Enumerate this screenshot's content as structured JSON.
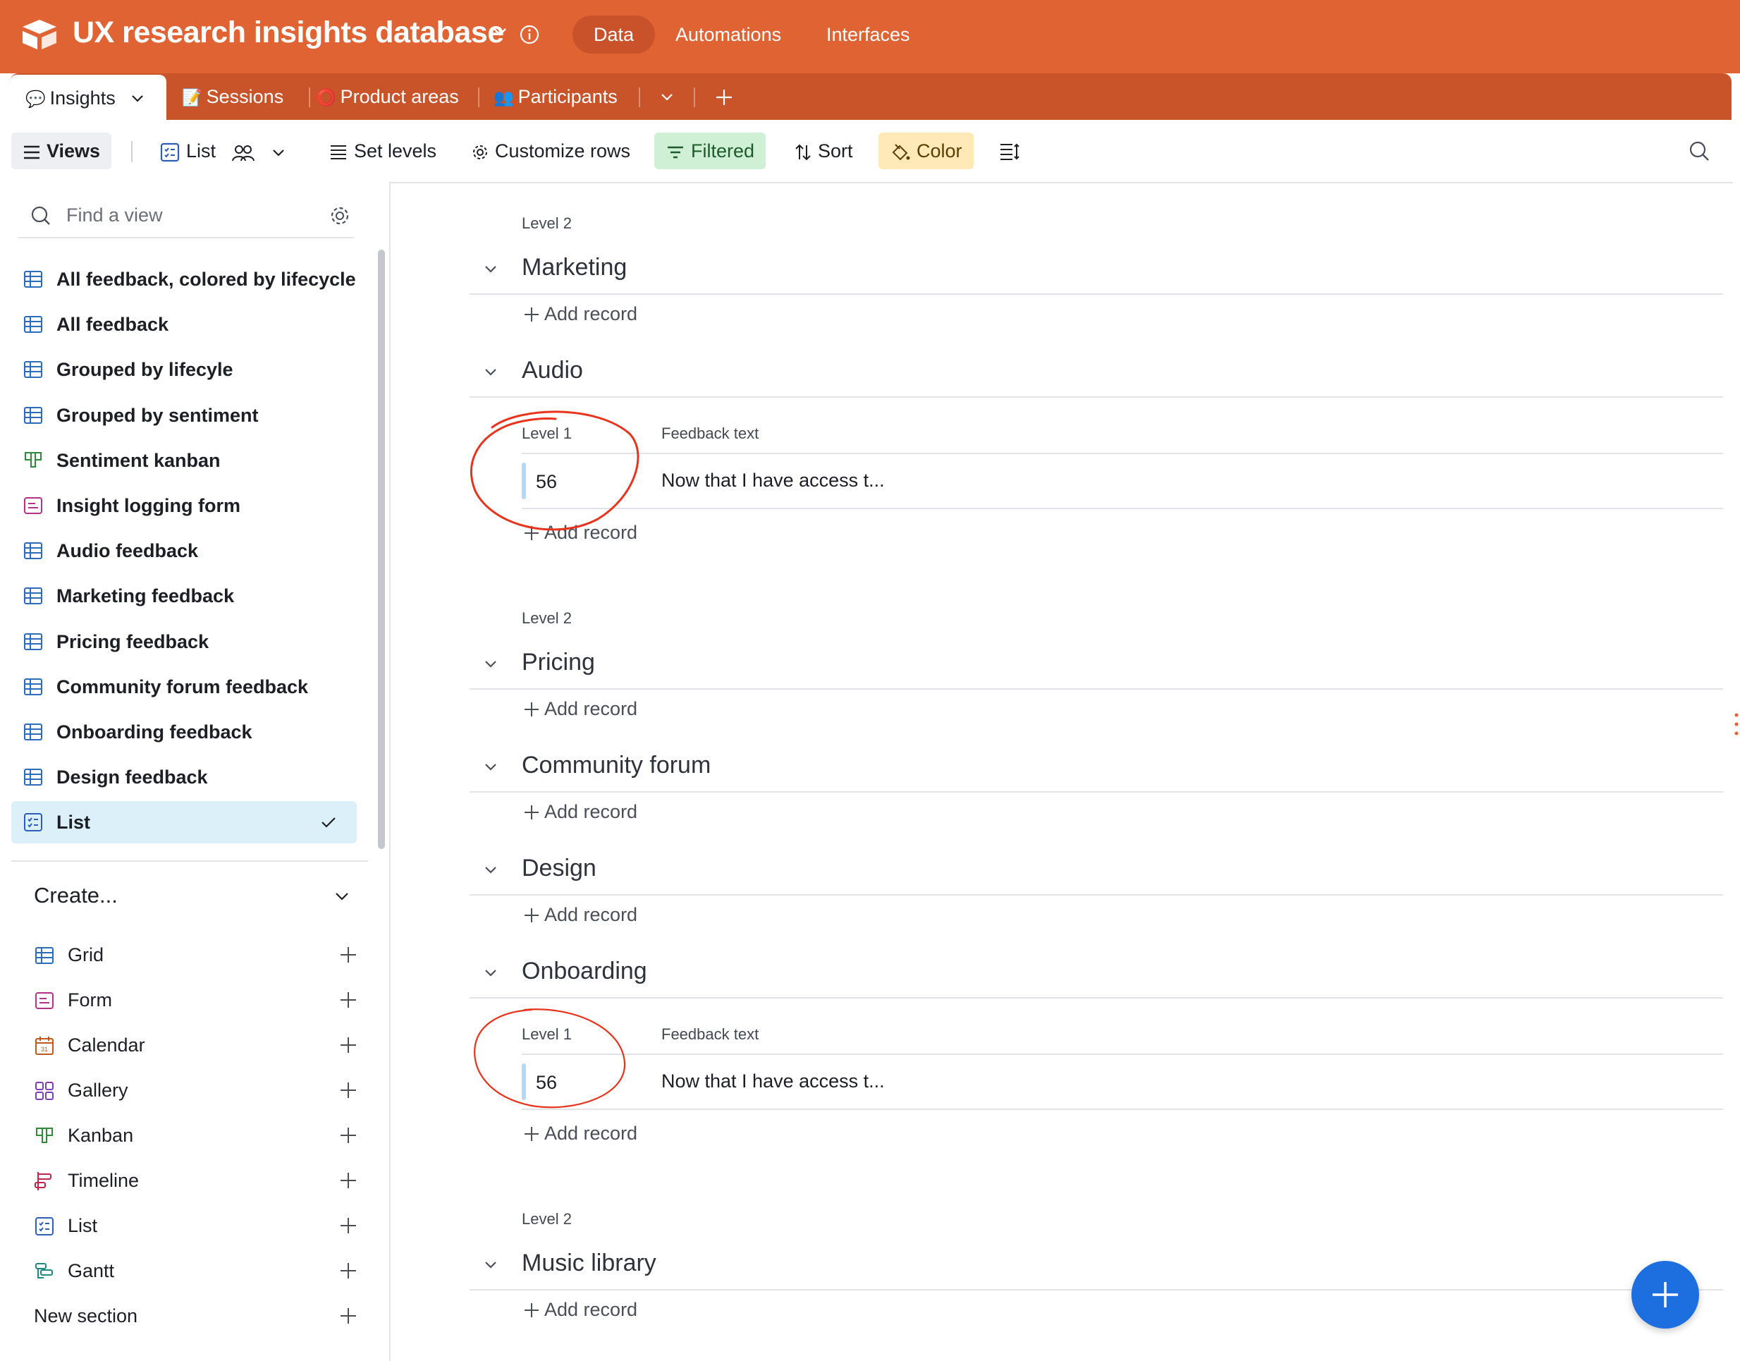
{
  "app": {
    "title": "UX research insights database",
    "nav": [
      "Data",
      "Automations",
      "Interfaces"
    ],
    "active_nav": "Data"
  },
  "tabs": [
    {
      "emoji": "💬",
      "label": "Insights"
    },
    {
      "emoji": "📝",
      "label": "Sessions"
    },
    {
      "emoji": "⭕",
      "label": "Product areas"
    },
    {
      "emoji": "👥",
      "label": "Participants"
    }
  ],
  "toolbar": {
    "views": "Views",
    "list": "List",
    "set_levels": "Set levels",
    "customize_rows": "Customize rows",
    "filtered": "Filtered",
    "sort": "Sort",
    "color": "Color"
  },
  "sidebar": {
    "find_placeholder": "Find a view",
    "views": [
      {
        "label": "All feedback, colored by lifecycle",
        "icon": "grid-icon"
      },
      {
        "label": "All feedback",
        "icon": "grid-icon"
      },
      {
        "label": "Grouped by lifecyle",
        "icon": "grid-icon"
      },
      {
        "label": "Grouped by sentiment",
        "icon": "grid-icon"
      },
      {
        "label": "Sentiment kanban",
        "icon": "kanban-icon"
      },
      {
        "label": "Insight logging form",
        "icon": "form-icon"
      },
      {
        "label": "Audio feedback",
        "icon": "grid-icon"
      },
      {
        "label": "Marketing feedback",
        "icon": "grid-icon"
      },
      {
        "label": "Pricing feedback",
        "icon": "grid-icon"
      },
      {
        "label": "Community forum feedback",
        "icon": "grid-icon"
      },
      {
        "label": "Onboarding feedback",
        "icon": "grid-icon"
      },
      {
        "label": "Design feedback",
        "icon": "grid-icon"
      },
      {
        "label": "List",
        "icon": "list-icon"
      }
    ],
    "selected_view": "List",
    "create_title": "Create...",
    "create_items": [
      {
        "label": "Grid",
        "icon": "grid-icon"
      },
      {
        "label": "Form",
        "icon": "form-icon"
      },
      {
        "label": "Calendar",
        "icon": "calendar-icon"
      },
      {
        "label": "Gallery",
        "icon": "gallery-icon"
      },
      {
        "label": "Kanban",
        "icon": "kanban-icon"
      },
      {
        "label": "Timeline",
        "icon": "timeline-icon"
      },
      {
        "label": "List",
        "icon": "list-icon"
      },
      {
        "label": "Gantt",
        "icon": "gantt-icon"
      },
      {
        "label": "New section",
        "icon": ""
      }
    ]
  },
  "main": {
    "level2_label": "Level 2",
    "level1_label": "Level 1",
    "feedback_header": "Feedback text",
    "add_record": "Add record",
    "groups": {
      "marketing": "Marketing",
      "audio": "Audio",
      "pricing": "Pricing",
      "community": "Community forum",
      "design": "Design",
      "onboarding": "Onboarding",
      "music": "Music library"
    },
    "records": {
      "audio": {
        "level1": "56",
        "feedback": "Now that I have access t..."
      },
      "onboarding": {
        "level1": "56",
        "feedback": "Now that I have access t..."
      }
    }
  },
  "colors": {
    "topbar": "#e06334",
    "tabsbar": "#c9542a",
    "selected_view": "#dcf0fa",
    "filtered_bg": "#d0f0d6",
    "color_bg": "#ffe9b8",
    "fab": "#1d6fe0",
    "annotation": "#e8341c"
  }
}
